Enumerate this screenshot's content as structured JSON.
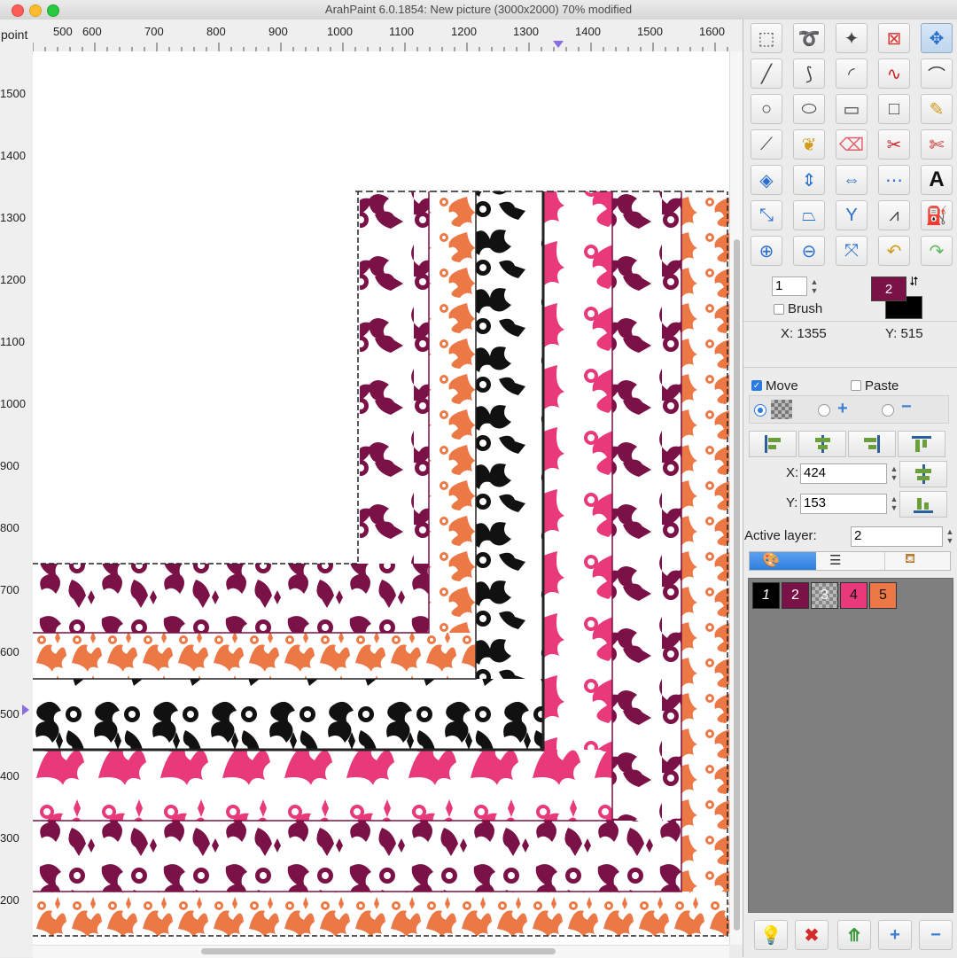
{
  "window": {
    "title": "ArahPaint 6.0.1854: New picture  (3000x2000) 70% modified"
  },
  "ruler": {
    "unit": "point",
    "top_ticks": [
      "500",
      "600",
      "700",
      "800",
      "900",
      "1000",
      "1100",
      "1200",
      "1300",
      "1400",
      "1500",
      "1600"
    ],
    "left_ticks": [
      "1500",
      "1400",
      "1300",
      "1200",
      "1100",
      "1000",
      "900",
      "800",
      "700",
      "600",
      "500",
      "400",
      "300",
      "200"
    ]
  },
  "tools": {
    "icons": [
      "rect-select-icon",
      "lasso-icon",
      "magic-wand-icon",
      "deselect-icon",
      "move-icon",
      "line-icon",
      "polyline-icon",
      "curve-icon",
      "bezier-red-icon",
      "bezier-icon",
      "ellipse-icon",
      "oval-icon",
      "rectangle-icon",
      "square-icon",
      "pencil-icon",
      "eyedropper-icon",
      "stamp-icon",
      "eraser-icon",
      "cut-icon",
      "scissors-icon",
      "recolor-icon",
      "mirror-vertical-icon",
      "mirror-horizontal-icon",
      "join-icon",
      "text-icon",
      "scale-icon",
      "perspective-icon",
      "symmetry-icon",
      "compass-icon",
      "bucket-icon",
      "zoom-in-icon",
      "zoom-out-icon",
      "fit-icon",
      "undo-icon",
      "redo-icon"
    ]
  },
  "brush": {
    "size": "1",
    "label": "Brush",
    "foreground_color_index": "2",
    "foreground_color": "#7a1147",
    "background_color": "#000000"
  },
  "cursor": {
    "x_label": "X: 1355",
    "y_label": "Y: 515"
  },
  "selection": {
    "move_label": "Move",
    "move_checked": true,
    "paste_label": "Paste",
    "paste_checked": false,
    "x_label": "X:",
    "x_value": "424",
    "y_label": "Y:",
    "y_value": "153"
  },
  "layers": {
    "active_label": "Active layer:",
    "active_value": "2",
    "chips": [
      {
        "label": "1",
        "color": "#000000",
        "text_color": "#ffffff"
      },
      {
        "label": "2",
        "color": "#7a1147",
        "text_color": "#ffffff"
      },
      {
        "label": "3",
        "color": "#9a9a9a",
        "text_color": "#ffffff"
      },
      {
        "label": "4",
        "color": "#e8397a",
        "text_color": "#111111"
      },
      {
        "label": "5",
        "color": "#ec7845",
        "text_color": "#111111"
      }
    ]
  },
  "colors": {
    "maroon": "#7a1147",
    "orange": "#ec7845",
    "black": "#111111",
    "pink": "#e8397a"
  }
}
